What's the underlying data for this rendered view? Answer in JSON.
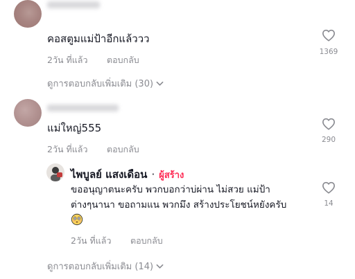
{
  "comments": [
    {
      "text": "คอสตูมแม่ป้าอีกแล้ววว",
      "time": "2วัน ที่แล้ว",
      "reply_label": "ตอบกลับ",
      "likes": "1369",
      "more_replies": "ดูการตอบกลับเพิ่มเติม (30)"
    },
    {
      "text": "แม่ใหญ่555",
      "time": "2วัน ที่แล้ว",
      "reply_label": "ตอบกลับ",
      "likes": "290",
      "reply": {
        "author": "ไพบูลย์ แสงเดือน",
        "separator": "·",
        "creator_badge": "ผู้สร้าง",
        "text_line1": "ขออนุญาตนะครับ พวกบอกว่าบ่ผ่าน ไม่สวย แม่ป้า",
        "text_line2": "ต่างๆนานา ขอถามแน พวกมึง สร้างประโยชน์หยังครับ",
        "time": "2วัน ที่แล้ว",
        "reply_label": "ตอบกลับ",
        "likes": "14"
      },
      "more_replies": "ดูการตอบกลับเพิ่มเติม (14)"
    }
  ],
  "colors": {
    "text": "#161823",
    "muted": "#8a8b91",
    "creator": "#fe2c55"
  },
  "icons": [
    "heart-outline-icon",
    "chevron-down-icon",
    "flushed-face-emoji"
  ]
}
